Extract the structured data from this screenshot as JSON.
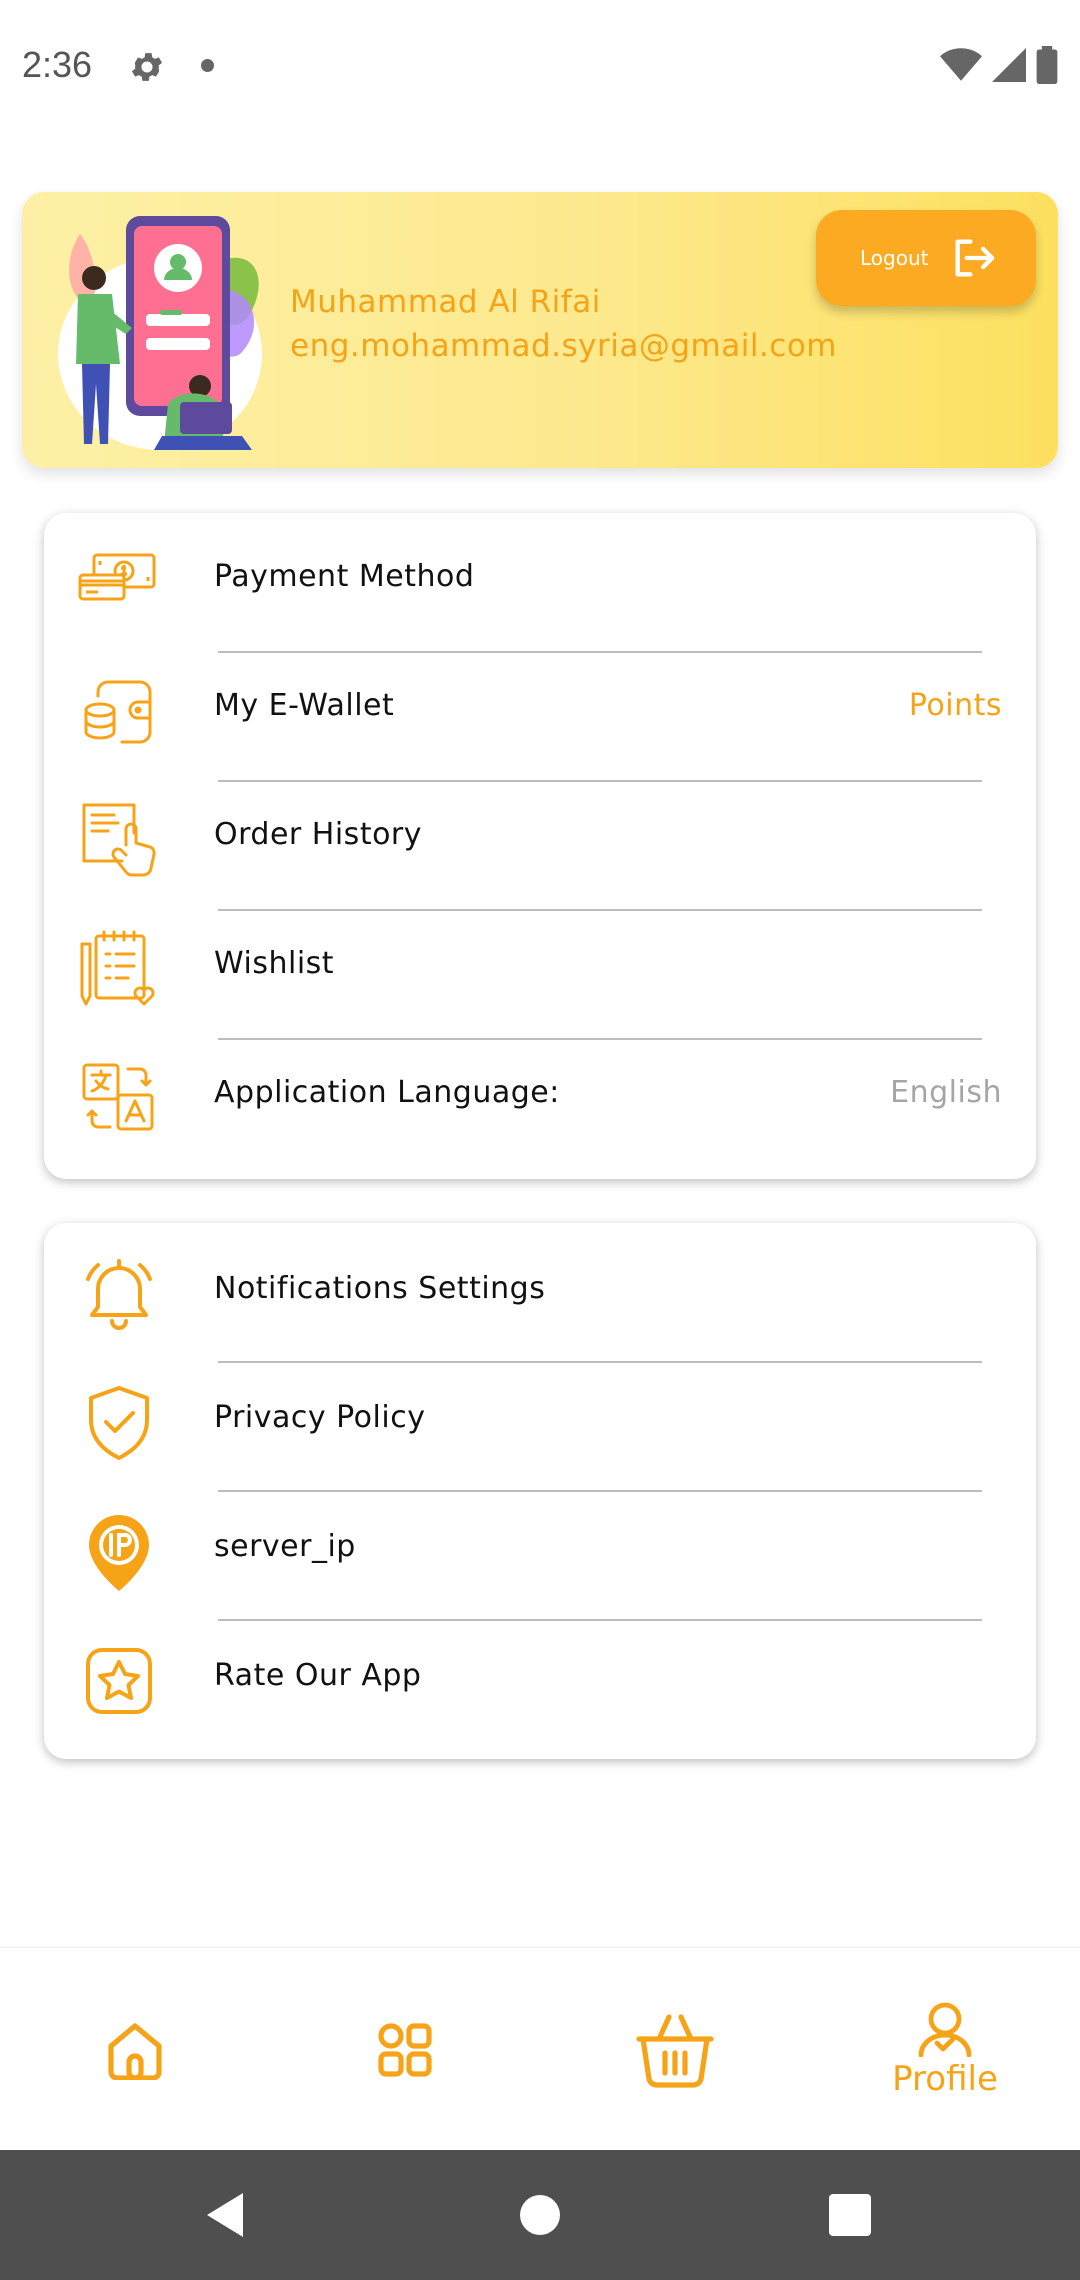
{
  "status_bar": {
    "time": "2:36"
  },
  "profile": {
    "name": "Muhammad Al Rifai",
    "email": "eng.mohammad.syria@gmail.com",
    "logout_label": "Logout"
  },
  "menu_group_1": [
    {
      "label": "Payment Method",
      "icon": "money-cards-icon",
      "value": ""
    },
    {
      "label": "My E-Wallet",
      "icon": "wallet-coins-icon",
      "value": "Points"
    },
    {
      "label": "Order History",
      "icon": "order-history-icon",
      "value": ""
    },
    {
      "label": "Wishlist",
      "icon": "wishlist-icon",
      "value": ""
    },
    {
      "label": "Application Language:",
      "icon": "translate-icon",
      "value": "English"
    }
  ],
  "menu_group_2": [
    {
      "label": "Notifications Settings",
      "icon": "bell-icon"
    },
    {
      "label": "Privacy Policy",
      "icon": "shield-check-icon"
    },
    {
      "label": "server_ip",
      "icon": "ip-pin-icon"
    },
    {
      "label": "Rate Our App",
      "icon": "star-icon"
    }
  ],
  "bottom_nav": {
    "items": [
      {
        "icon": "home-icon",
        "label": ""
      },
      {
        "icon": "categories-grid-icon",
        "label": ""
      },
      {
        "icon": "basket-icon",
        "label": ""
      },
      {
        "icon": "profile-icon",
        "label": "Profile"
      }
    ],
    "active_index": 3
  },
  "colors": {
    "accent": "#f7a317",
    "button": "#fcaa22",
    "banner_start": "#fdf0a6",
    "banner_end": "#fde05f",
    "muted_text": "#a5a5a5",
    "system_nav": "#4f4f4f"
  }
}
